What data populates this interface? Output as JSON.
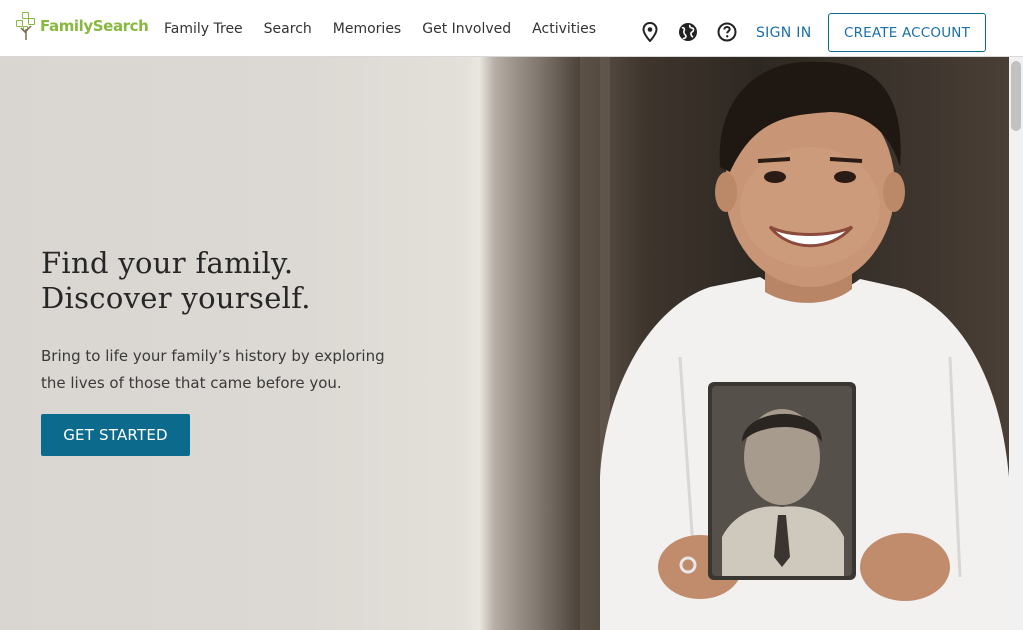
{
  "header": {
    "logo_text": "FamilySearch",
    "nav_items": [
      "Family Tree",
      "Search",
      "Memories",
      "Get Involved",
      "Activities"
    ],
    "icons": [
      "location-pin-icon",
      "globe-icon",
      "help-icon"
    ],
    "sign_in": "SIGN IN",
    "create_account": "CREATE ACCOUNT"
  },
  "hero": {
    "headline_line1": "Find your family.",
    "headline_line2": "Discover yourself.",
    "subtext_line1": "Bring to life your family’s history by exploring",
    "subtext_line2": "the lives of those that came before you.",
    "cta": "GET STARTED"
  },
  "colors": {
    "brand_green": "#87b940",
    "link_blue": "#1b6fa8",
    "cta_bg": "#0c6b8c"
  }
}
